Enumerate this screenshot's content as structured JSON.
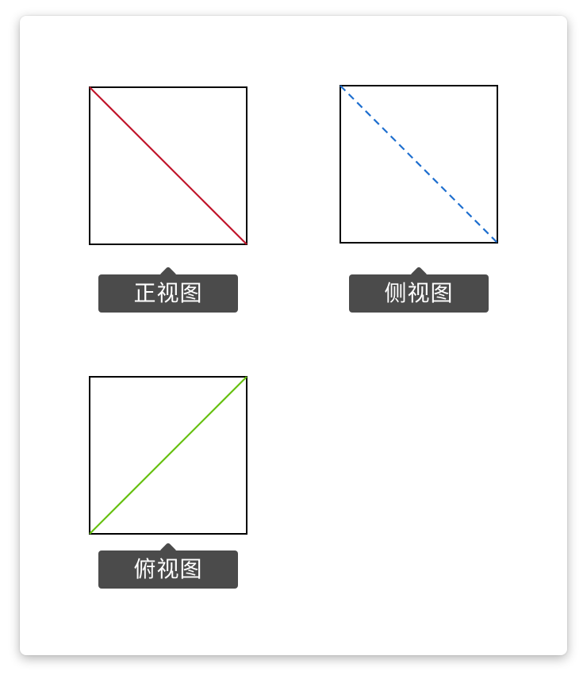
{
  "views": [
    {
      "label": "正视图",
      "line_color": "#c0152b",
      "line_style": "solid",
      "diagonal": "top-left-to-bottom-right"
    },
    {
      "label": "侧视图",
      "line_color": "#1f6fcf",
      "line_style": "dashed",
      "diagonal": "top-left-to-bottom-right"
    },
    {
      "label": "俯视图",
      "line_color": "#66c010",
      "line_style": "solid",
      "diagonal": "bottom-left-to-top-right"
    }
  ]
}
